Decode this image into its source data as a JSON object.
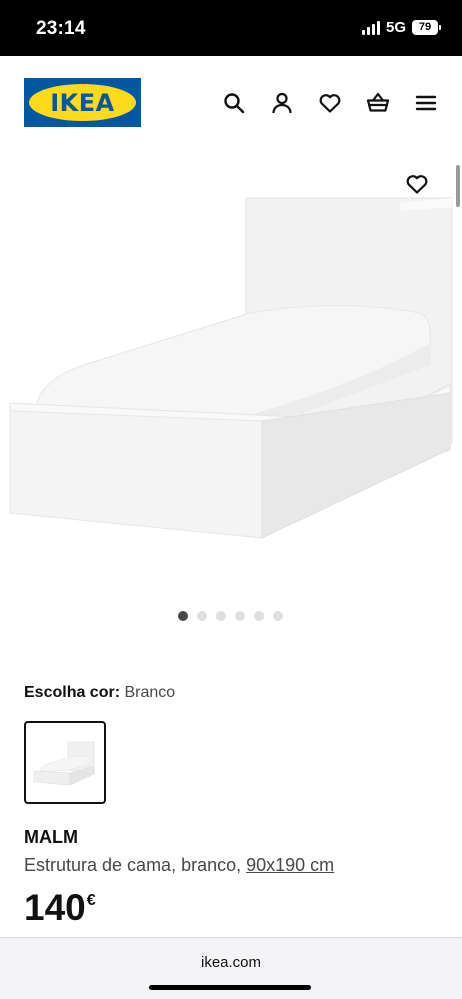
{
  "status_bar": {
    "time": "23:14",
    "network": "5G",
    "battery": "79"
  },
  "header": {
    "logo_text": "IKEA",
    "icons": [
      "search-icon",
      "user-icon",
      "heart-icon",
      "cart-icon",
      "menu-icon"
    ],
    "colors": {
      "brand_blue": "#0058a3",
      "brand_yellow": "#ffda1a"
    }
  },
  "gallery": {
    "image_count": 6,
    "active_index": 0,
    "favorite_icon": "heart-icon"
  },
  "color_choice": {
    "label": "Escolha cor:",
    "value": "Branco"
  },
  "product": {
    "name": "MALM",
    "description": "Estrutura de cama, branco,",
    "size_link": "90x190 cm",
    "price": "140",
    "currency": "€"
  },
  "browser": {
    "url": "ikea.com"
  }
}
